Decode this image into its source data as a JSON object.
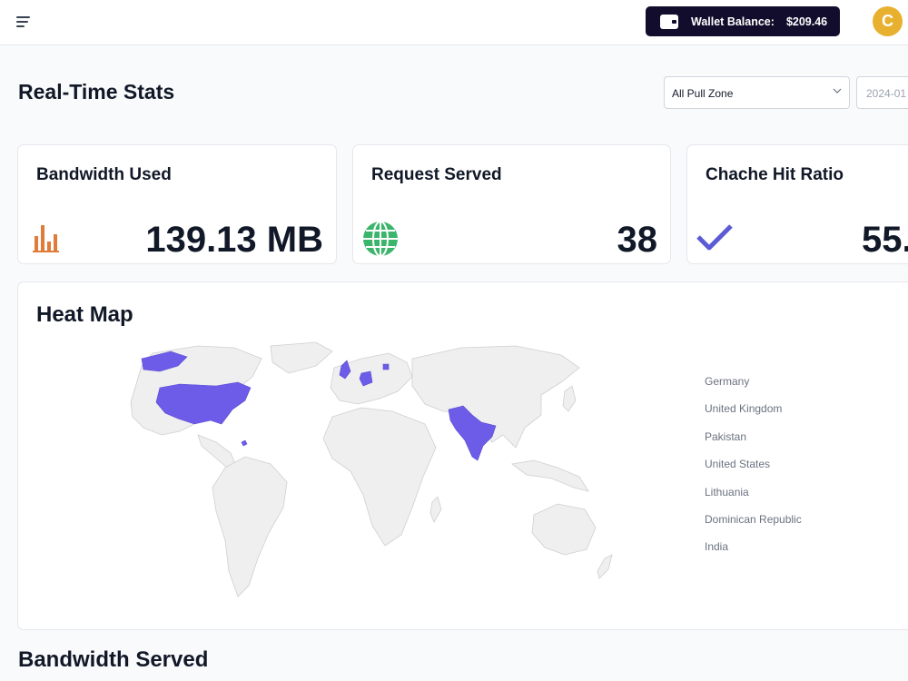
{
  "header": {
    "menu_icon": "hamburger-menu-icon",
    "wallet": {
      "label": "Wallet Balance:",
      "amount": "$209.46",
      "icon": "wallet-icon"
    },
    "avatar_initial": "C",
    "avatar_color": "#e8b02f",
    "wallet_bg": "#120d2c"
  },
  "page": {
    "title": "Real-Time Stats",
    "filter": {
      "selected": "All Pull Zone"
    },
    "date_value": "2024-01"
  },
  "cards": [
    {
      "title": "Bandwidth Used",
      "value": "139.13 MB",
      "icon": "bar-chart-icon",
      "icon_color": "#e07b39"
    },
    {
      "title": "Request Served",
      "value": "38",
      "icon": "globe-icon",
      "icon_color": "#3bb56b"
    },
    {
      "title": "Chache Hit Ratio",
      "value": "55.",
      "icon": "checkmark-icon",
      "icon_color": "#5b5bd6"
    }
  ],
  "heatmap": {
    "title": "Heat Map",
    "highlight_color": "#6c5ce7",
    "base_color": "#efefef",
    "countries": [
      "Germany",
      "United Kingdom",
      "Pakistan",
      "United States",
      "Lithuania",
      "Dominican Republic",
      "India"
    ]
  },
  "bandwidth_section": {
    "title": "Bandwidth Served"
  }
}
